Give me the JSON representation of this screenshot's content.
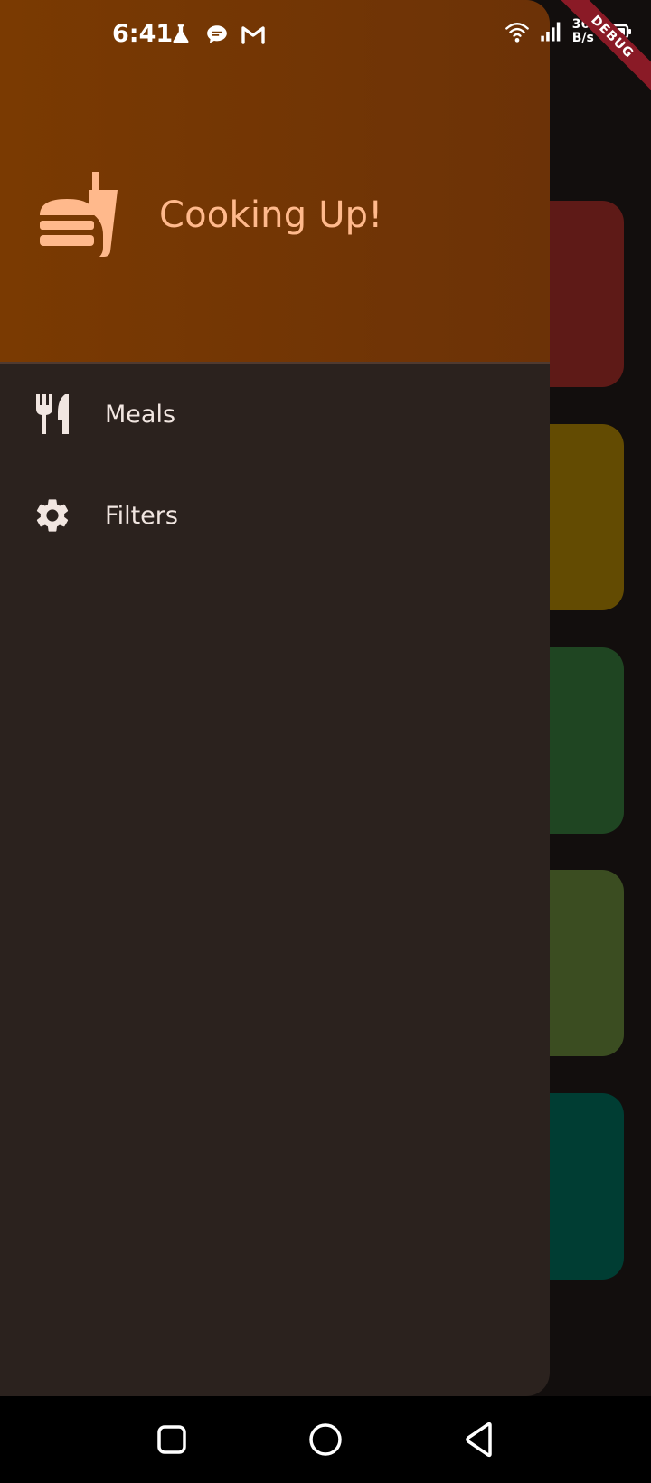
{
  "status_bar": {
    "time": "6:41",
    "net_speed_value": "362",
    "net_speed_unit": "B/s",
    "left_icons": [
      "flask-icon",
      "chat-bubble-icon",
      "gmail-icon"
    ],
    "right_icons": [
      "wifi-icon",
      "cell-signal-icon",
      "battery-icon"
    ]
  },
  "debug_banner": "DEBUG",
  "drawer": {
    "header": {
      "icon": "fastfood-icon",
      "title": "Cooking Up!",
      "accent_color": "#ffb98c",
      "background_color": "#7a3a02"
    },
    "items": [
      {
        "label": "Meals",
        "icon": "restaurant-icon"
      },
      {
        "label": "Filters",
        "icon": "settings-icon"
      }
    ]
  },
  "background_cards": {
    "colors": [
      "#5e1a17",
      "#634b02",
      "#1f4522",
      "#3b4d21",
      "#003d33"
    ]
  },
  "nav_bar": {
    "buttons": [
      "recents-button",
      "home-button",
      "back-button"
    ]
  }
}
